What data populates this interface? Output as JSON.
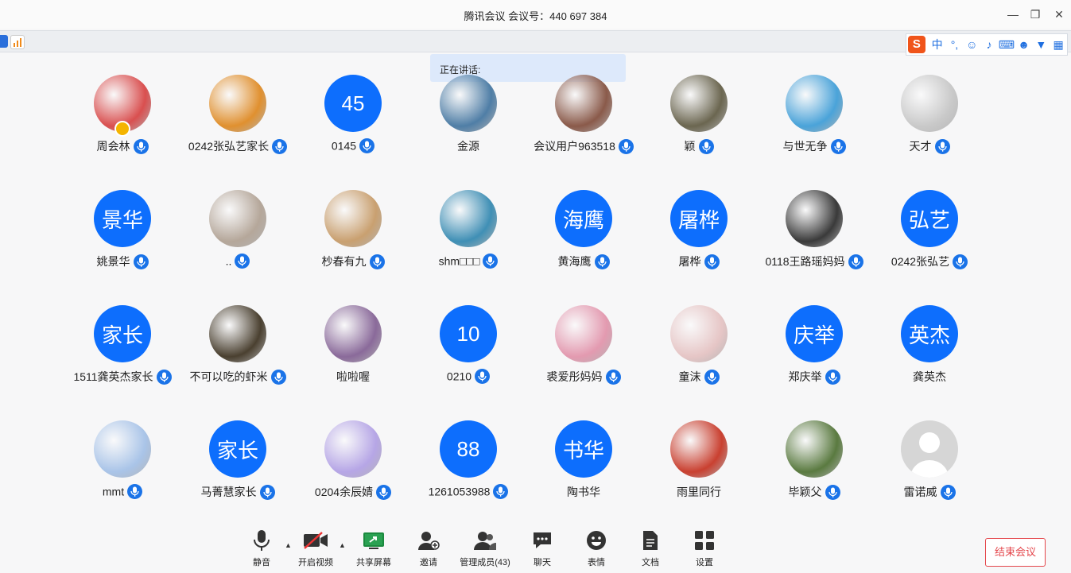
{
  "window": {
    "title": "腾讯会议 会议号：440 697 384"
  },
  "speaking": {
    "label": "正在讲话:"
  },
  "participants": [
    {
      "name": "周会林",
      "avatar": "photo",
      "color": "#d94f4f",
      "mic": true,
      "host": true
    },
    {
      "name": "0242张弘艺家长",
      "avatar": "photo",
      "color": "#e0902f",
      "mic": true
    },
    {
      "name": "0145",
      "avatar": "text",
      "text": "45",
      "mic": true
    },
    {
      "name": "金源",
      "avatar": "photo",
      "color": "#4f7ea6",
      "mic": false
    },
    {
      "name": "会议用户963518",
      "avatar": "photo",
      "color": "#8a5a4a",
      "mic": true
    },
    {
      "name": "颖",
      "avatar": "photo",
      "color": "#6b6650",
      "mic": true
    },
    {
      "name": "与世无争",
      "avatar": "photo",
      "color": "#4aa3d9",
      "mic": true
    },
    {
      "name": "天才",
      "avatar": "photo",
      "color": "#c9c9c9",
      "mic": true
    },
    {
      "name": "姚景华",
      "avatar": "text",
      "text": "景华",
      "mic": true
    },
    {
      "name": "..",
      "avatar": "photo",
      "color": "#b5a79a",
      "mic": true
    },
    {
      "name": "杪春有九",
      "avatar": "photo",
      "color": "#c9a070",
      "mic": true
    },
    {
      "name": "shm□□□",
      "avatar": "photo",
      "color": "#3f8fb5",
      "mic": true
    },
    {
      "name": "黄海鹰",
      "avatar": "text",
      "text": "海鹰",
      "mic": true
    },
    {
      "name": "屠桦",
      "avatar": "text",
      "text": "屠桦",
      "mic": true
    },
    {
      "name": "0118王路瑶妈妈",
      "avatar": "photo",
      "color": "#3a3a3a",
      "mic": true
    },
    {
      "name": "0242张弘艺",
      "avatar": "text",
      "text": "弘艺",
      "mic": true
    },
    {
      "name": "1511龚英杰家长",
      "avatar": "text",
      "text": "家长",
      "mic": true
    },
    {
      "name": "不可以吃的虾米",
      "avatar": "photo",
      "color": "#4a4030",
      "mic": true
    },
    {
      "name": "啦啦喔",
      "avatar": "photo",
      "color": "#8a6a9a",
      "mic": false
    },
    {
      "name": "0210",
      "avatar": "text",
      "text": "10",
      "mic": true
    },
    {
      "name": "裘爱彤妈妈",
      "avatar": "photo",
      "color": "#e39ab0",
      "mic": true
    },
    {
      "name": "童沫",
      "avatar": "photo",
      "color": "#e6c6c6",
      "mic": true
    },
    {
      "name": "郑庆举",
      "avatar": "text",
      "text": "庆举",
      "mic": true
    },
    {
      "name": "龚英杰",
      "avatar": "text",
      "text": "英杰",
      "mic": false
    },
    {
      "name": "mmt",
      "avatar": "photo",
      "color": "#a9c4e8",
      "mic": true
    },
    {
      "name": "马菁慧家长",
      "avatar": "text",
      "text": "家长",
      "mic": true
    },
    {
      "name": "0204余辰婧",
      "avatar": "photo",
      "color": "#b6a6e6",
      "mic": true
    },
    {
      "name": "1261053988",
      "avatar": "text",
      "text": "88",
      "mic": true
    },
    {
      "name": "陶书华",
      "avatar": "text",
      "text": "书华",
      "mic": false
    },
    {
      "name": "雨里同行",
      "avatar": "photo",
      "color": "#c94030",
      "mic": false
    },
    {
      "name": "毕颖父",
      "avatar": "photo",
      "color": "#5a7a40",
      "mic": true
    },
    {
      "name": "雷诺威",
      "avatar": "default",
      "color": "#d6d6d6",
      "mic": true
    }
  ],
  "toolbar": {
    "mute": "静音",
    "video": "开启视频",
    "share": "共享屏幕",
    "invite": "邀请",
    "members": "管理成员(43)",
    "chat": "聊天",
    "emoji": "表情",
    "docs": "文档",
    "settings": "设置",
    "end": "结束会议"
  },
  "colors": {
    "accent": "#0d6efd",
    "end": "#e4464b"
  }
}
